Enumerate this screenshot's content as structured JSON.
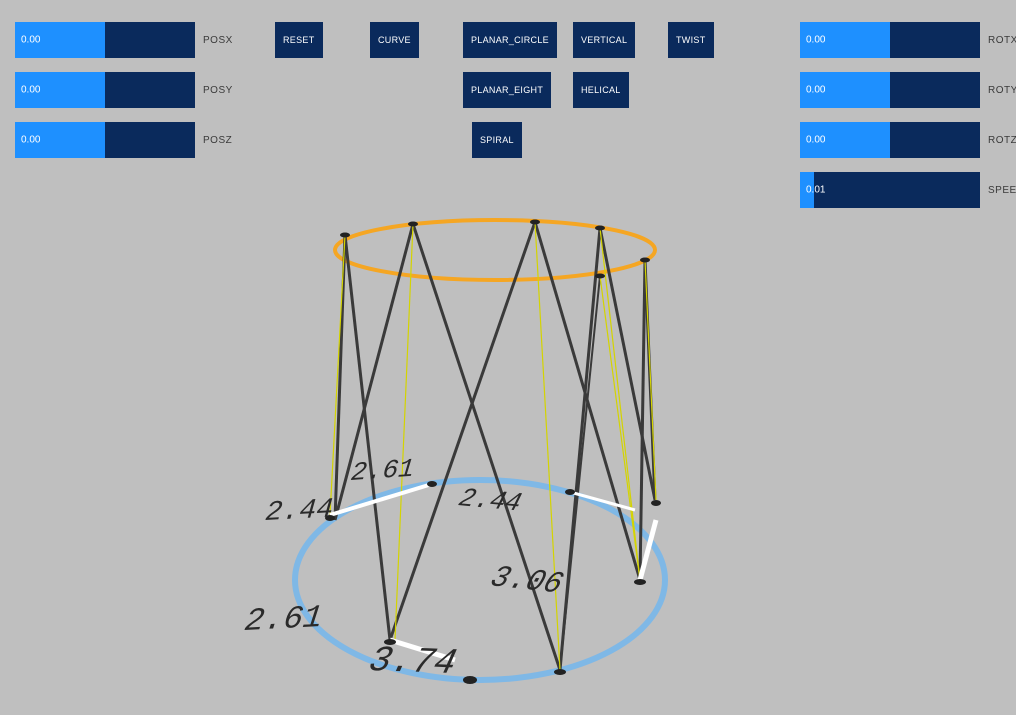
{
  "sliders": {
    "posx": {
      "label": "POSX",
      "value": "0.00",
      "fill": 50
    },
    "posy": {
      "label": "POSY",
      "value": "0.00",
      "fill": 50
    },
    "posz": {
      "label": "POSZ",
      "value": "0.00",
      "fill": 50
    },
    "rotx": {
      "label": "ROTX",
      "value": "0.00",
      "fill": 50
    },
    "roty": {
      "label": "ROTY",
      "value": "0.00",
      "fill": 50
    },
    "rotz": {
      "label": "ROTZ",
      "value": "0.00",
      "fill": 50
    },
    "speed": {
      "label": "SPEED",
      "value": "0.01",
      "fill": 8
    }
  },
  "buttons": {
    "reset": "RESET",
    "curve": "CURVE",
    "planar_circle": "PLANAR_CIRCLE",
    "planar_eight": "PLANAR_EIGHT",
    "spiral": "SPIRAL",
    "vertical": "VERTICAL",
    "helical": "HELICAL",
    "twist": "TWIST"
  },
  "annotations": {
    "a1": "2.61",
    "a2": "2.44",
    "a3": "2.44",
    "a4": "3.06",
    "a5": "2.61",
    "a6": "3.74"
  }
}
